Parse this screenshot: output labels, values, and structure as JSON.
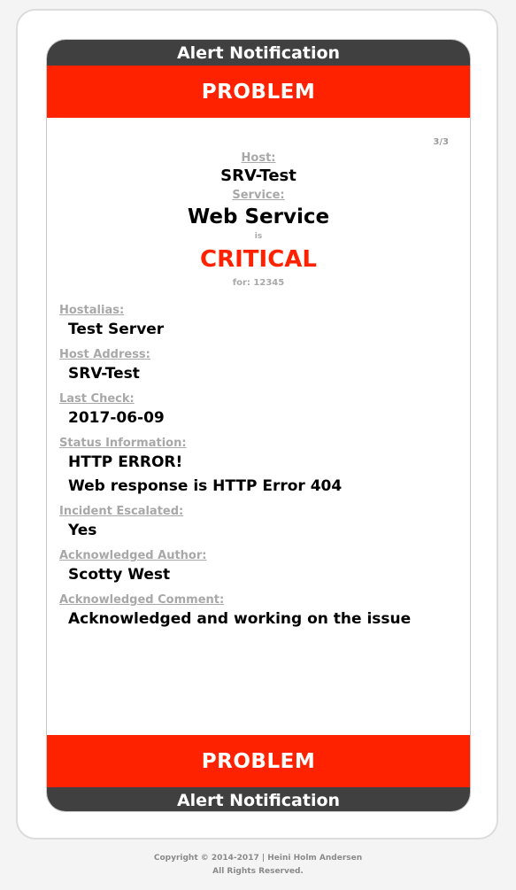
{
  "header": {
    "top_title": "Alert Notification",
    "status": "PROBLEM"
  },
  "counter": "3/3",
  "summary": {
    "host_label": "Host:",
    "host_value": "SRV-Test",
    "service_label": "Service:",
    "service_value": "Web Service",
    "is_text": "is",
    "state": "CRITICAL",
    "for_text": "for: 12345"
  },
  "fields": {
    "hostalias": {
      "label": "Hostalias:",
      "value": "Test Server"
    },
    "host_address": {
      "label": "Host Address:",
      "value": "SRV-Test"
    },
    "last_check": {
      "label": "Last Check:",
      "value": "2017-06-09"
    },
    "status_information": {
      "label": "Status Information:",
      "line1": "HTTP ERROR!",
      "line2": "Web response is HTTP Error 404"
    },
    "incident_escalated": {
      "label": "Incident Escalated:",
      "value": "Yes"
    },
    "ack_author": {
      "label": "Acknowledged Author:",
      "value": "Scotty West"
    },
    "ack_comment": {
      "label": "Acknowledged Comment:",
      "value": "Acknowledged and working on the issue"
    }
  },
  "bottom": {
    "status": "PROBLEM",
    "title": "Alert Notification"
  },
  "footer": {
    "copyright": "Copyright © 2014-2017 | Heini Holm Andersen",
    "rights": "All Rights Reserved."
  },
  "colors": {
    "problem_red": "#ff2200",
    "dark_bar": "#404040",
    "label_gray": "#a8a8a8"
  }
}
